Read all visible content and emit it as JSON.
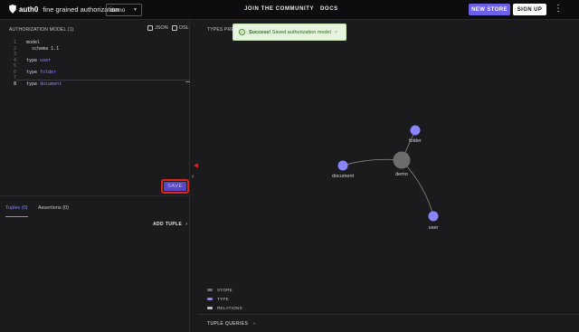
{
  "header": {
    "brand": "auth0",
    "product": "fine grained authorization",
    "store_select": "demo",
    "nav": [
      "JOIN THE COMMUNITY",
      "DOCS"
    ],
    "new_store": "NEW STORE",
    "sign_up": "SIGN UP"
  },
  "model_panel": {
    "title": "AUTHORIZATION MODEL (1)",
    "json_label": "JSON",
    "dsl_label": "DSL",
    "lines": [
      {
        "num": "1",
        "text": "model"
      },
      {
        "num": "2",
        "text": "  schema 1.1"
      },
      {
        "num": "3",
        "text": ""
      },
      {
        "num": "4",
        "kw": "type ",
        "name": "user"
      },
      {
        "num": "5",
        "text": ""
      },
      {
        "num": "6",
        "kw": "type ",
        "name": "folder"
      },
      {
        "num": "7",
        "text": ""
      },
      {
        "num": "8",
        "kw": "type ",
        "name": "document"
      }
    ],
    "save_label": "SAVE"
  },
  "tuples": {
    "tabs": [
      "Tuples (0)",
      "Assertions (0)"
    ],
    "add_tuple": "ADD TUPLE"
  },
  "preview": {
    "title": "TYPES PREVIEW",
    "nodes": {
      "center": "demo",
      "folder": "folder",
      "document": "document",
      "user": "user"
    },
    "legend": [
      "STORE",
      "TYPE",
      "RELATIONS"
    ],
    "tuple_queries": "TUPLE QUERIES"
  },
  "toast": {
    "bold": "Success!",
    "message": " Saved authorization model"
  },
  "colors": {
    "accent": "#6c5fe8",
    "type_node": "#8a84ff",
    "store_node": "#6d6d6d",
    "highlight": "#e0241d"
  }
}
